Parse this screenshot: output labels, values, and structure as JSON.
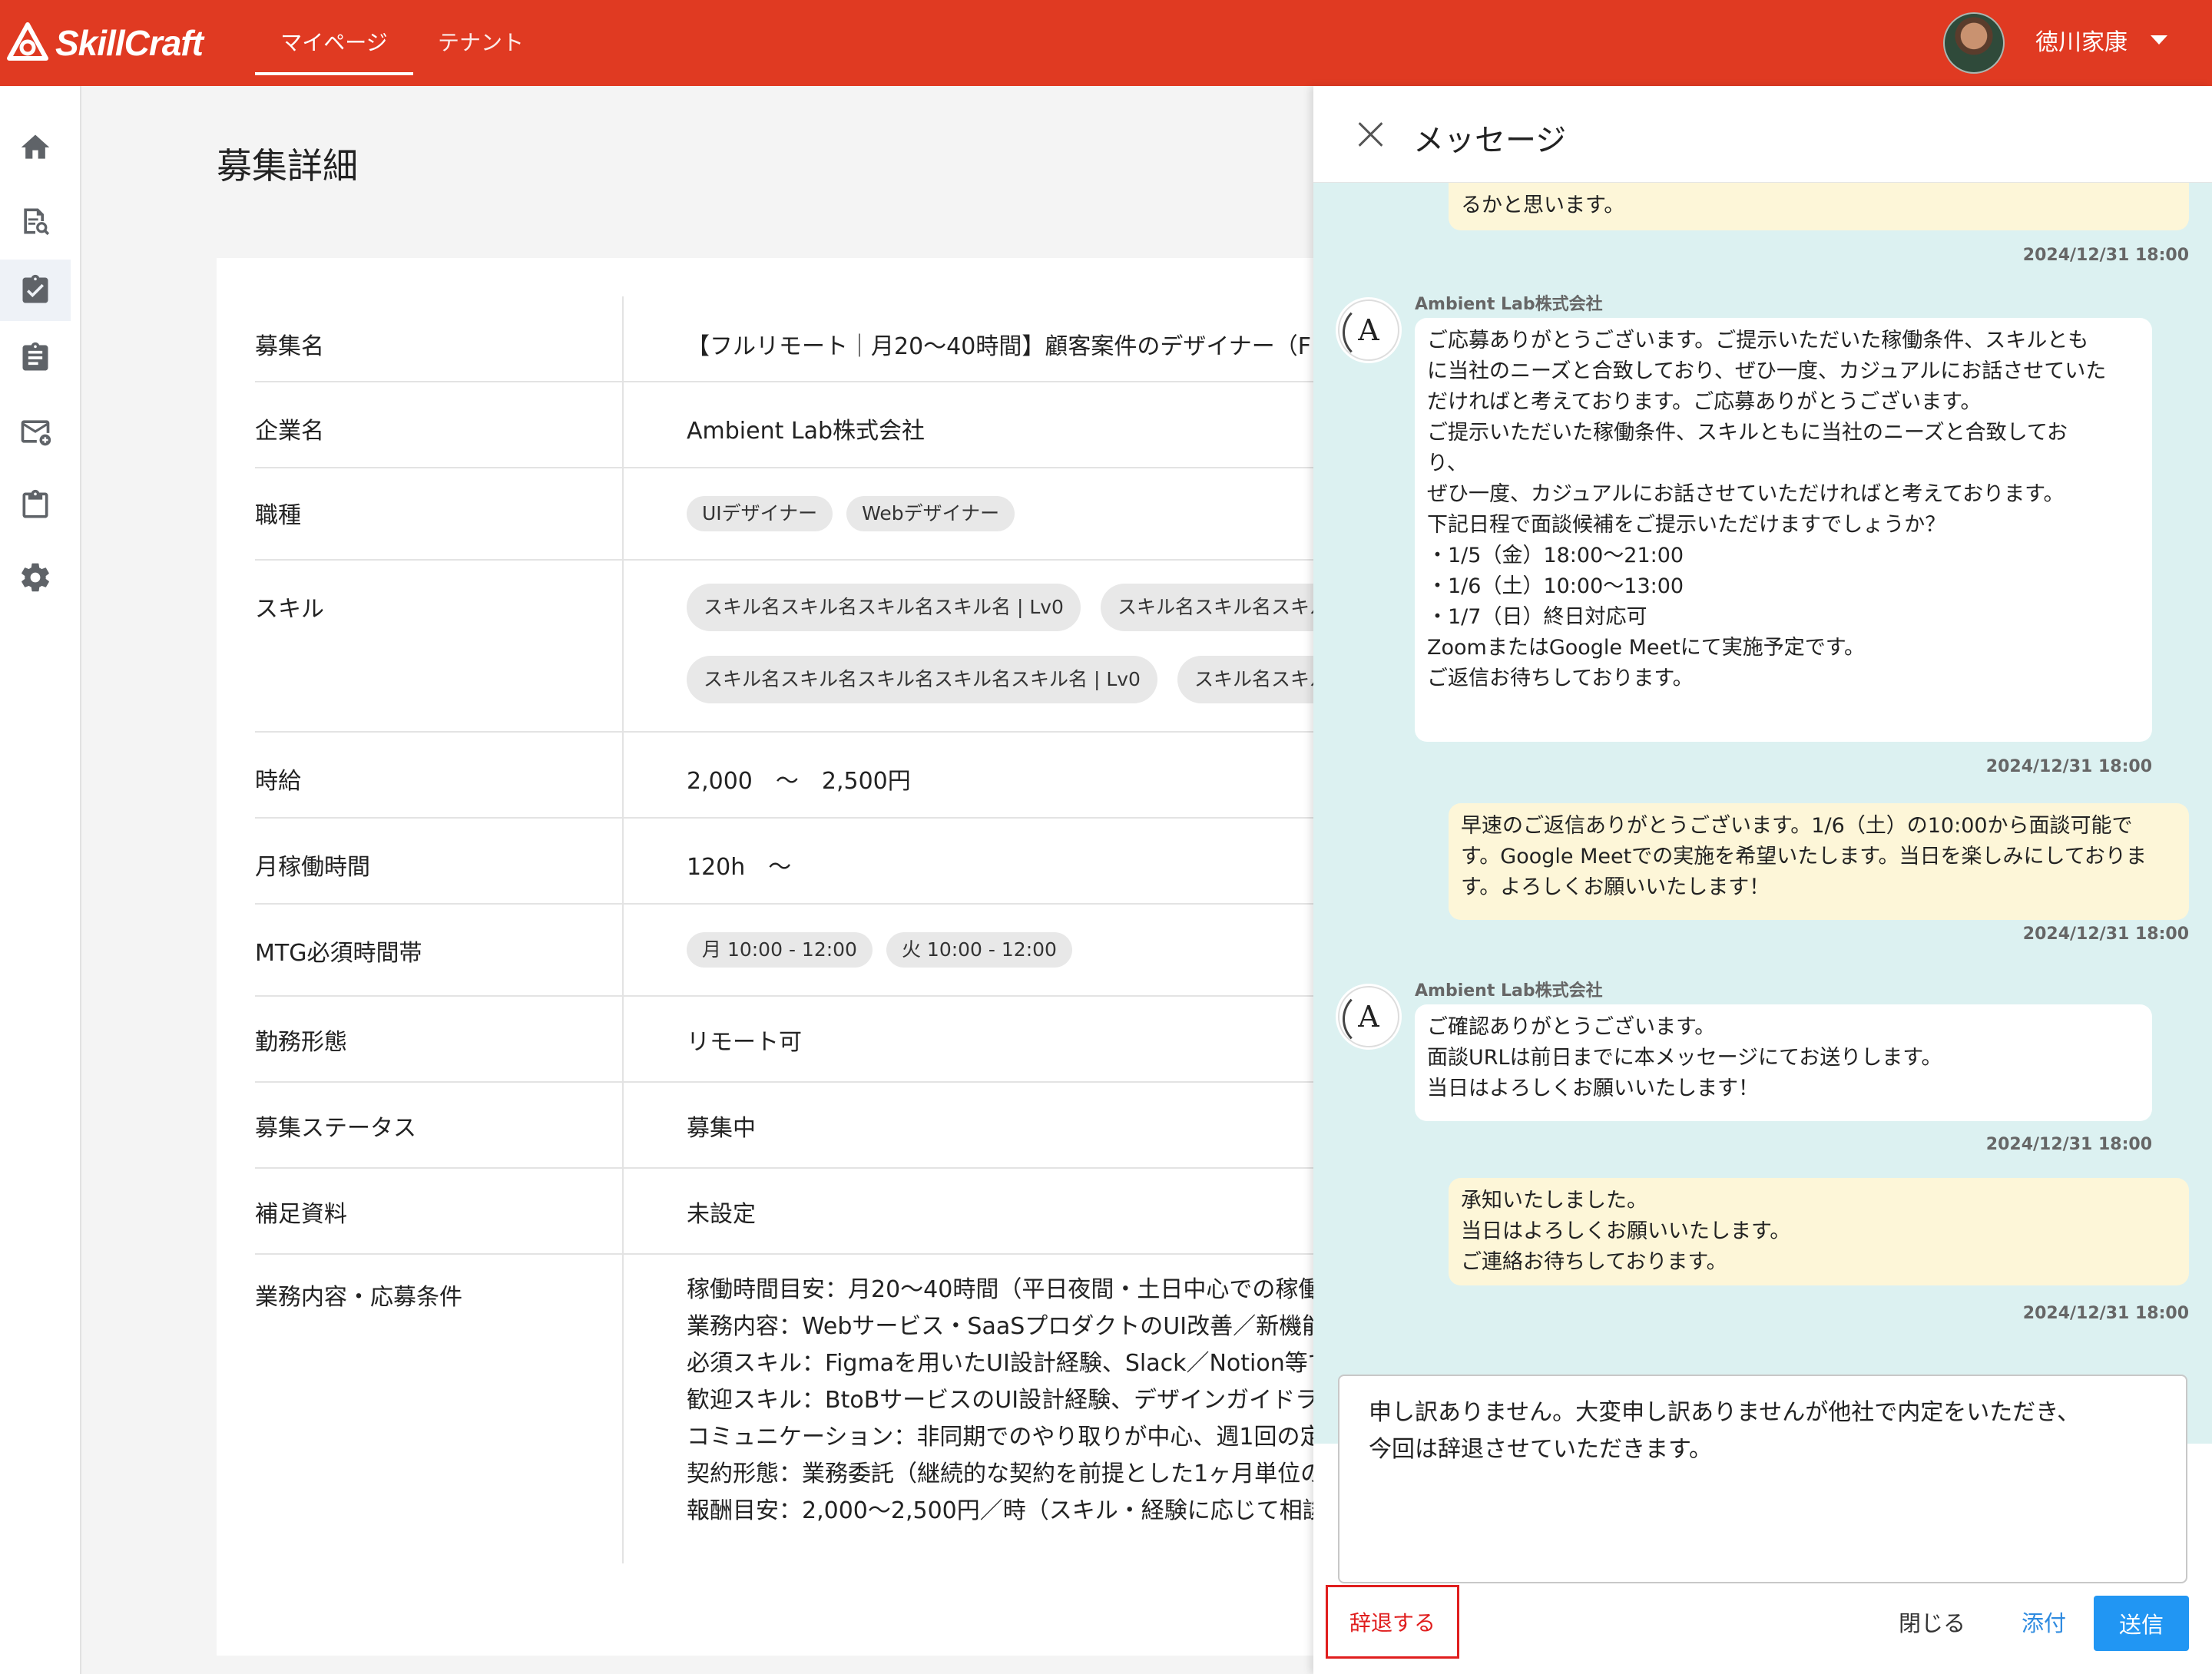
{
  "header": {
    "logo_text": "SkillCraft",
    "tabs": [
      {
        "label": "マイページ"
      },
      {
        "label": "テナント"
      }
    ],
    "user_name": "徳川家康"
  },
  "sidebar": {
    "items": [
      {
        "icon": "home-icon"
      },
      {
        "icon": "search-document-icon"
      },
      {
        "icon": "task-check-icon",
        "active": true
      },
      {
        "icon": "assignment-icon"
      },
      {
        "icon": "mail-add-icon"
      },
      {
        "icon": "clipboard-icon"
      },
      {
        "icon": "gear-icon"
      }
    ]
  },
  "page": {
    "title": "募集詳細",
    "rows": {
      "name": {
        "label": "募集名",
        "value": "【フルリモート｜月20〜40時間】顧客案件のデザイナー（F"
      },
      "company": {
        "label": "企業名",
        "value": "Ambient Lab株式会社"
      },
      "job": {
        "label": "職種",
        "chips": [
          "UIデザイナー",
          "Webデザイナー"
        ]
      },
      "skill": {
        "label": "スキル",
        "chips": [
          "スキル名スキル名スキル名スキル名 | Lv0",
          "スキル名スキル名スキル",
          "スキル名スキル名スキル名スキル名スキル名 | Lv0",
          "スキル名スキル"
        ]
      },
      "wage": {
        "label": "時給",
        "value": "2,000　〜　2,500円"
      },
      "hours": {
        "label": "月稼働時間",
        "value": "120h　〜"
      },
      "mtg": {
        "label": "MTG必須時間帯",
        "chips": [
          "月 10:00 - 12:00",
          "火 10:00 - 12:00"
        ]
      },
      "style": {
        "label": "勤務形態",
        "value": "リモート可"
      },
      "status": {
        "label": "募集ステータス",
        "value": "募集中"
      },
      "material": {
        "label": "補足資料",
        "value": "未設定"
      },
      "details": {
        "label": "業務内容・応募条件",
        "lines": [
          "稼働時間目安：月20〜40時間（平日夜間・土日中心での稼働",
          "業務内容：Webサービス・SaaSプロダクトのUI改善／新機能",
          "必須スキル：Figmaを用いたUI設計経験、Slack／Notion等で",
          "歓迎スキル：BtoBサービスのUI設計経験、デザインガイドラ",
          "コミュニケーション：非同期でのやり取りが中心、週1回の定",
          "契約形態：業務委託（継続的な契約を前提とした1ヶ月単位の",
          "報酬目安：2,000〜2,500円／時（スキル・経験に応じて相談"
        ]
      }
    }
  },
  "messages": {
    "title": "メッセージ",
    "items": [
      {
        "from": "me",
        "text": "るかと思います。",
        "time": "2024/12/31 18:00"
      },
      {
        "from": "company",
        "sender": "Ambient Lab株式会社",
        "avatar_letter": "A",
        "text": "ご応募ありがとうございます。ご提示いただいた稼働条件、スキルとも\nに当社のニーズと合致しており、ぜひ一度、カジュアルにお話させていた\nだければと考えております。ご応募ありがとうございます。\n ご提示いただいた稼働条件、スキルともに当社のニーズと合致してお\nり、\n ぜひ一度、カジュアルにお話させていただければと考えております。\n 下記日程で面談候補をご提示いただけますでしょうか？\n ・1/5（金）18:00〜21:00\n ・1/6（土）10:00〜13:00\n ・1/7（日）終日対応可\nZoomまたはGoogle Meetにて実施予定です。\n ご返信お待ちしております。",
        "time": "2024/12/31 18:00"
      },
      {
        "from": "me",
        "text": "早速のご返信ありがとうございます。1/6（土）の10:00から面談可能で\nす。Google Meetでの実施を希望いたします。当日を楽しみにしておりま\nす。よろしくお願いいたします！",
        "time": "2024/12/31 18:00"
      },
      {
        "from": "company",
        "sender": "Ambient Lab株式会社",
        "avatar_letter": "A",
        "text": "ご確認ありがとうございます。\n 面談URLは前日までに本メッセージにてお送りします。\n 当日はよろしくお願いいたします！",
        "time": "2024/12/31 18:00"
      },
      {
        "from": "me",
        "text": "承知いたしました。\n 当日はよろしくお願いいたします。\n ご連絡お待ちしております。",
        "time": "2024/12/31 18:00"
      }
    ],
    "composer_value": "申し訳ありません。大変申し訳ありませんが他社で内定をいただき、\n今回は辞退させていただきます。",
    "decline_label": "辞退する",
    "close_label": "閉じる",
    "attach_label": "添付",
    "send_label": "送信"
  },
  "colors": {
    "brand": "#e03a22",
    "chat_bg": "#dcf1f1",
    "my_bubble": "#fdf6d8",
    "send": "#2196f3",
    "decline": "#e01e1e"
  }
}
